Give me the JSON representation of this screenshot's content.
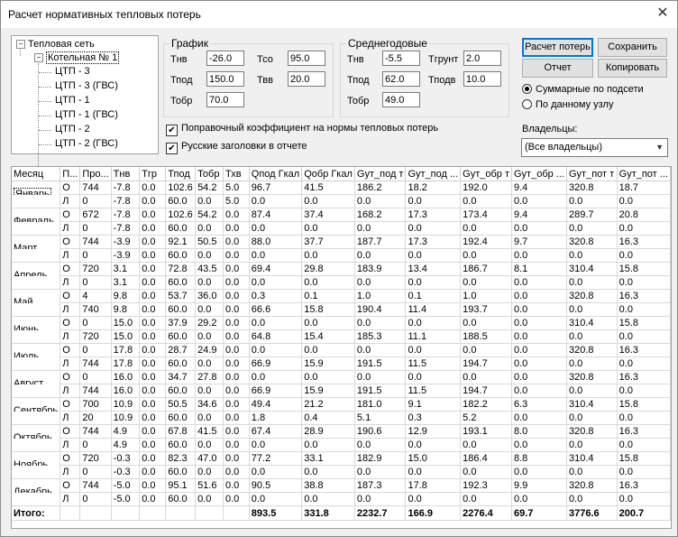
{
  "window": {
    "title": "Расчет нормативных тепловых потерь",
    "close": "✕"
  },
  "tree": {
    "root": "Тепловая сеть",
    "boiler": "Котельная № 1",
    "children": [
      "ЦТП - 3",
      "ЦТП - 3 (ГВС)",
      "ЦТП - 1",
      "ЦТП - 1 (ГВС)",
      "ЦТП - 2",
      "ЦТП - 2 (ГВС)"
    ]
  },
  "schedule": {
    "title": "График",
    "tnv_label": "Тнв",
    "tnv": "-26.0",
    "tpod_label": "Тпод",
    "tpod": "150.0",
    "tobr_label": "Тобр",
    "tobr": "70.0",
    "tso_label": "Тсо",
    "tso": "95.0",
    "tvv_label": "Твв",
    "tvv": "20.0"
  },
  "annual": {
    "title": "Среднегодовые",
    "tnv_label": "Тнв",
    "tnv": "-5.5",
    "tpod_label": "Тпод",
    "tpod": "62.0",
    "tobr_label": "Тобр",
    "tobr": "49.0",
    "tgrunt_label": "Тгрунт",
    "tgrunt": "2.0",
    "tpodv_label": "Тподв",
    "tpodv": "10.0"
  },
  "buttons": {
    "calc": "Расчет потерь",
    "save": "Сохранить",
    "report": "Отчет",
    "copy": "Копировать"
  },
  "options": {
    "correction": "Поправочный коэффициент на нормы тепловых потерь",
    "russian_headers": "Русские заголовки в отчете",
    "radio_total": "Суммарные по подсети",
    "radio_node": "По данному узлу",
    "owners_label": "Владельцы:",
    "owners_value": "(Все владельцы)"
  },
  "table": {
    "columns": [
      "Месяц",
      "П...",
      "Про...",
      "Тнв",
      "Тгр",
      "Тпод",
      "Тобр",
      "Тхв",
      "Qпод Гкал",
      "Qобр Гкал",
      "Gут_под т",
      "Gут_под ...",
      "Gут_обр т",
      "Gут_обр ...",
      "Gут_пот т",
      "Gут_пот ..."
    ],
    "months": [
      {
        "name": "Январь",
        "rows": [
          [
            "О",
            "744",
            "-7.8",
            "0.0",
            "102.6",
            "54.2",
            "5.0",
            "96.7",
            "41.5",
            "186.2",
            "18.2",
            "192.0",
            "9.4",
            "320.8",
            "18.7"
          ],
          [
            "Л",
            "0",
            "-7.8",
            "0.0",
            "60.0",
            "0.0",
            "5.0",
            "0.0",
            "0.0",
            "0.0",
            "0.0",
            "0.0",
            "0.0",
            "0.0",
            "0.0"
          ]
        ]
      },
      {
        "name": "Февраль",
        "rows": [
          [
            "О",
            "672",
            "-7.8",
            "0.0",
            "102.6",
            "54.2",
            "0.0",
            "87.4",
            "37.4",
            "168.2",
            "17.3",
            "173.4",
            "9.4",
            "289.7",
            "20.8"
          ],
          [
            "Л",
            "0",
            "-7.8",
            "0.0",
            "60.0",
            "0.0",
            "0.0",
            "0.0",
            "0.0",
            "0.0",
            "0.0",
            "0.0",
            "0.0",
            "0.0",
            "0.0"
          ]
        ]
      },
      {
        "name": "Март",
        "rows": [
          [
            "О",
            "744",
            "-3.9",
            "0.0",
            "92.1",
            "50.5",
            "0.0",
            "88.0",
            "37.7",
            "187.7",
            "17.3",
            "192.4",
            "9.7",
            "320.8",
            "16.3"
          ],
          [
            "Л",
            "0",
            "-3.9",
            "0.0",
            "60.0",
            "0.0",
            "0.0",
            "0.0",
            "0.0",
            "0.0",
            "0.0",
            "0.0",
            "0.0",
            "0.0",
            "0.0"
          ]
        ]
      },
      {
        "name": "Апрель",
        "rows": [
          [
            "О",
            "720",
            "3.1",
            "0.0",
            "72.8",
            "43.5",
            "0.0",
            "69.4",
            "29.8",
            "183.9",
            "13.4",
            "186.7",
            "8.1",
            "310.4",
            "15.8"
          ],
          [
            "Л",
            "0",
            "3.1",
            "0.0",
            "60.0",
            "0.0",
            "0.0",
            "0.0",
            "0.0",
            "0.0",
            "0.0",
            "0.0",
            "0.0",
            "0.0",
            "0.0"
          ]
        ]
      },
      {
        "name": "Май",
        "rows": [
          [
            "О",
            "4",
            "9.8",
            "0.0",
            "53.7",
            "36.0",
            "0.0",
            "0.3",
            "0.1",
            "1.0",
            "0.1",
            "1.0",
            "0.0",
            "320.8",
            "16.3"
          ],
          [
            "Л",
            "740",
            "9.8",
            "0.0",
            "60.0",
            "0.0",
            "0.0",
            "66.6",
            "15.8",
            "190.4",
            "11.4",
            "193.7",
            "0.0",
            "0.0",
            "0.0"
          ]
        ]
      },
      {
        "name": "Июнь",
        "rows": [
          [
            "О",
            "0",
            "15.0",
            "0.0",
            "37.9",
            "29.2",
            "0.0",
            "0.0",
            "0.0",
            "0.0",
            "0.0",
            "0.0",
            "0.0",
            "310.4",
            "15.8"
          ],
          [
            "Л",
            "720",
            "15.0",
            "0.0",
            "60.0",
            "0.0",
            "0.0",
            "64.8",
            "15.4",
            "185.3",
            "11.1",
            "188.5",
            "0.0",
            "0.0",
            "0.0"
          ]
        ]
      },
      {
        "name": "Июль",
        "rows": [
          [
            "О",
            "0",
            "17.8",
            "0.0",
            "28.7",
            "24.9",
            "0.0",
            "0.0",
            "0.0",
            "0.0",
            "0.0",
            "0.0",
            "0.0",
            "320.8",
            "16.3"
          ],
          [
            "Л",
            "744",
            "17.8",
            "0.0",
            "60.0",
            "0.0",
            "0.0",
            "66.9",
            "15.9",
            "191.5",
            "11.5",
            "194.7",
            "0.0",
            "0.0",
            "0.0"
          ]
        ]
      },
      {
        "name": "Август",
        "rows": [
          [
            "О",
            "0",
            "16.0",
            "0.0",
            "34.7",
            "27.8",
            "0.0",
            "0.0",
            "0.0",
            "0.0",
            "0.0",
            "0.0",
            "0.0",
            "320.8",
            "16.3"
          ],
          [
            "Л",
            "744",
            "16.0",
            "0.0",
            "60.0",
            "0.0",
            "0.0",
            "66.9",
            "15.9",
            "191.5",
            "11.5",
            "194.7",
            "0.0",
            "0.0",
            "0.0"
          ]
        ]
      },
      {
        "name": "Сентябрь",
        "rows": [
          [
            "О",
            "700",
            "10.9",
            "0.0",
            "50.5",
            "34.6",
            "0.0",
            "49.4",
            "21.2",
            "181.0",
            "9.1",
            "182.2",
            "6.3",
            "310.4",
            "15.8"
          ],
          [
            "Л",
            "20",
            "10.9",
            "0.0",
            "60.0",
            "0.0",
            "0.0",
            "1.8",
            "0.4",
            "5.1",
            "0.3",
            "5.2",
            "0.0",
            "0.0",
            "0.0"
          ]
        ]
      },
      {
        "name": "Октябрь",
        "rows": [
          [
            "О",
            "744",
            "4.9",
            "0.0",
            "67.8",
            "41.5",
            "0.0",
            "67.4",
            "28.9",
            "190.6",
            "12.9",
            "193.1",
            "8.0",
            "320.8",
            "16.3"
          ],
          [
            "Л",
            "0",
            "4.9",
            "0.0",
            "60.0",
            "0.0",
            "0.0",
            "0.0",
            "0.0",
            "0.0",
            "0.0",
            "0.0",
            "0.0",
            "0.0",
            "0.0"
          ]
        ]
      },
      {
        "name": "Ноябрь",
        "rows": [
          [
            "О",
            "720",
            "-0.3",
            "0.0",
            "82.3",
            "47.0",
            "0.0",
            "77.2",
            "33.1",
            "182.9",
            "15.0",
            "186.4",
            "8.8",
            "310.4",
            "15.8"
          ],
          [
            "Л",
            "0",
            "-0.3",
            "0.0",
            "60.0",
            "0.0",
            "0.0",
            "0.0",
            "0.0",
            "0.0",
            "0.0",
            "0.0",
            "0.0",
            "0.0",
            "0.0"
          ]
        ]
      },
      {
        "name": "Декабрь",
        "rows": [
          [
            "О",
            "744",
            "-5.0",
            "0.0",
            "95.1",
            "51.6",
            "0.0",
            "90.5",
            "38.8",
            "187.3",
            "17.8",
            "192.3",
            "9.9",
            "320.8",
            "16.3"
          ],
          [
            "Л",
            "0",
            "-5.0",
            "0.0",
            "60.0",
            "0.0",
            "0.0",
            "0.0",
            "0.0",
            "0.0",
            "0.0",
            "0.0",
            "0.0",
            "0.0",
            "0.0"
          ]
        ]
      }
    ],
    "total": {
      "label": "Итого:",
      "values": [
        "",
        "",
        "",
        "",
        "",
        "",
        "",
        "893.5",
        "331.8",
        "2232.7",
        "166.9",
        "2276.4",
        "69.7",
        "3776.6",
        "200.7"
      ]
    }
  }
}
